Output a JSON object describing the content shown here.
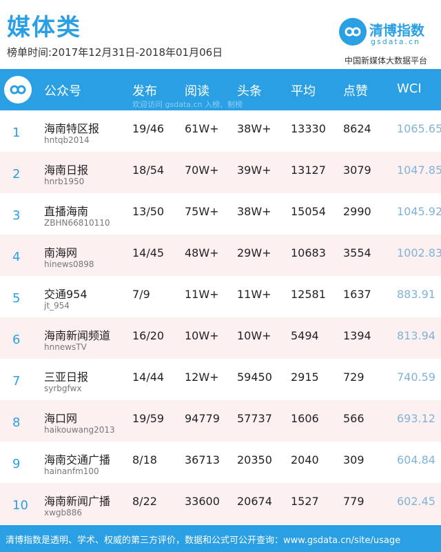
{
  "header": {
    "title": "媒体类",
    "date_range": "榜单时间:2017年12月31日-2018年01月06日",
    "brand_name": "清博指数",
    "brand_domain": "gsdata.cn",
    "tagline": "中国新媒体大数据平台"
  },
  "table": {
    "columns": [
      "公众号",
      "发布",
      "阅读",
      "头条",
      "平均",
      "点赞",
      "WCI"
    ],
    "watermark": "欢迎访问 gsdata.cn 入榜、制榜",
    "rows": [
      {
        "rank": "1",
        "name": "海南特区报",
        "account": "hntqb2014",
        "publish": "19/46",
        "read": "61W+",
        "headline": "38W+",
        "avg": "13330",
        "likes": "8624",
        "wci": "1065.65"
      },
      {
        "rank": "2",
        "name": "海南日报",
        "account": "hnrb1950",
        "publish": "18/54",
        "read": "70W+",
        "headline": "39W+",
        "avg": "13127",
        "likes": "3079",
        "wci": "1047.85"
      },
      {
        "rank": "3",
        "name": "直播海南",
        "account": "ZBHN66810110",
        "publish": "13/50",
        "read": "75W+",
        "headline": "38W+",
        "avg": "15054",
        "likes": "2990",
        "wci": "1045.92"
      },
      {
        "rank": "4",
        "name": "南海网",
        "account": "hinews0898",
        "publish": "14/45",
        "read": "48W+",
        "headline": "29W+",
        "avg": "10683",
        "likes": "3554",
        "wci": "1002.83"
      },
      {
        "rank": "5",
        "name": "交通954",
        "account": "jt_954",
        "publish": "7/9",
        "read": "11W+",
        "headline": "11W+",
        "avg": "12581",
        "likes": "1637",
        "wci": "883.91"
      },
      {
        "rank": "6",
        "name": "海南新闻频道",
        "account": "hnnewsTV",
        "publish": "16/20",
        "read": "10W+",
        "headline": "10W+",
        "avg": "5494",
        "likes": "1394",
        "wci": "813.94"
      },
      {
        "rank": "7",
        "name": "三亚日报",
        "account": "syrbgfwx",
        "publish": "14/44",
        "read": "12W+",
        "headline": "59450",
        "avg": "2915",
        "likes": "729",
        "wci": "740.59"
      },
      {
        "rank": "8",
        "name": "海口网",
        "account": "haikouwang2013",
        "publish": "19/59",
        "read": "94779",
        "headline": "57737",
        "avg": "1606",
        "likes": "566",
        "wci": "693.12"
      },
      {
        "rank": "9",
        "name": "海南交通广播",
        "account": "hainanfm100",
        "publish": "8/18",
        "read": "36713",
        "headline": "20350",
        "avg": "2040",
        "likes": "309",
        "wci": "604.84"
      },
      {
        "rank": "10",
        "name": "海南新闻广播",
        "account": "xwgb886",
        "publish": "8/22",
        "read": "33600",
        "headline": "20674",
        "avg": "1527",
        "likes": "779",
        "wci": "602.45"
      }
    ]
  },
  "footer": {
    "text": "清博指数是透明、学术、权威的第三方评价，数据和公式可公开查询：www.gsdata.cn/site/usage"
  },
  "colors": {
    "brand_blue": "#2a9fe4",
    "row_alt": "#fdf0f0",
    "wci_text": "#7fb3d8"
  },
  "icons": {
    "brand_logo": "infinity-link-icon",
    "header_logo": "infinity-link-icon"
  }
}
